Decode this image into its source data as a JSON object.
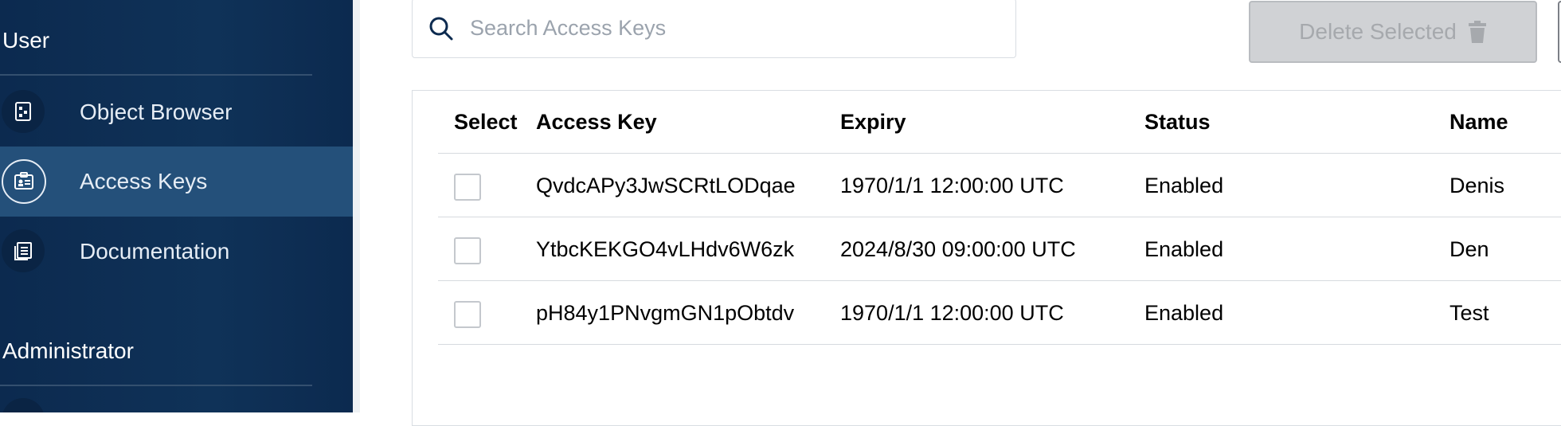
{
  "sidebar": {
    "user_section": "User",
    "admin_section": "Administrator",
    "items": [
      {
        "label": "Object Browser",
        "icon": "object-browser-icon"
      },
      {
        "label": "Access Keys",
        "icon": "access-keys-icon",
        "active": true
      },
      {
        "label": "Documentation",
        "icon": "documentation-icon"
      }
    ]
  },
  "search": {
    "placeholder": "Search Access Keys"
  },
  "toolbar": {
    "delete_label": "Delete Selected"
  },
  "table": {
    "headers": {
      "select": "Select",
      "access_key": "Access Key",
      "expiry": "Expiry",
      "status": "Status",
      "name": "Name"
    },
    "rows": [
      {
        "access_key": "QvdcAPy3JwSCRtLODqae",
        "expiry": "1970/1/1 12:00:00 UTC",
        "status": "Enabled",
        "name": "Denis"
      },
      {
        "access_key": "YtbcKEKGO4vLHdv6W6zk",
        "expiry": "2024/8/30 09:00:00 UTC",
        "status": "Enabled",
        "name": "Den"
      },
      {
        "access_key": "pH84y1PNvgmGN1pObtdv",
        "expiry": "1970/1/1 12:00:00 UTC",
        "status": "Enabled",
        "name": "Test"
      }
    ]
  },
  "colors": {
    "sidebar_bg": "#0f3258",
    "active_item": "#24507a",
    "disabled_button": "#d0d2d5"
  }
}
